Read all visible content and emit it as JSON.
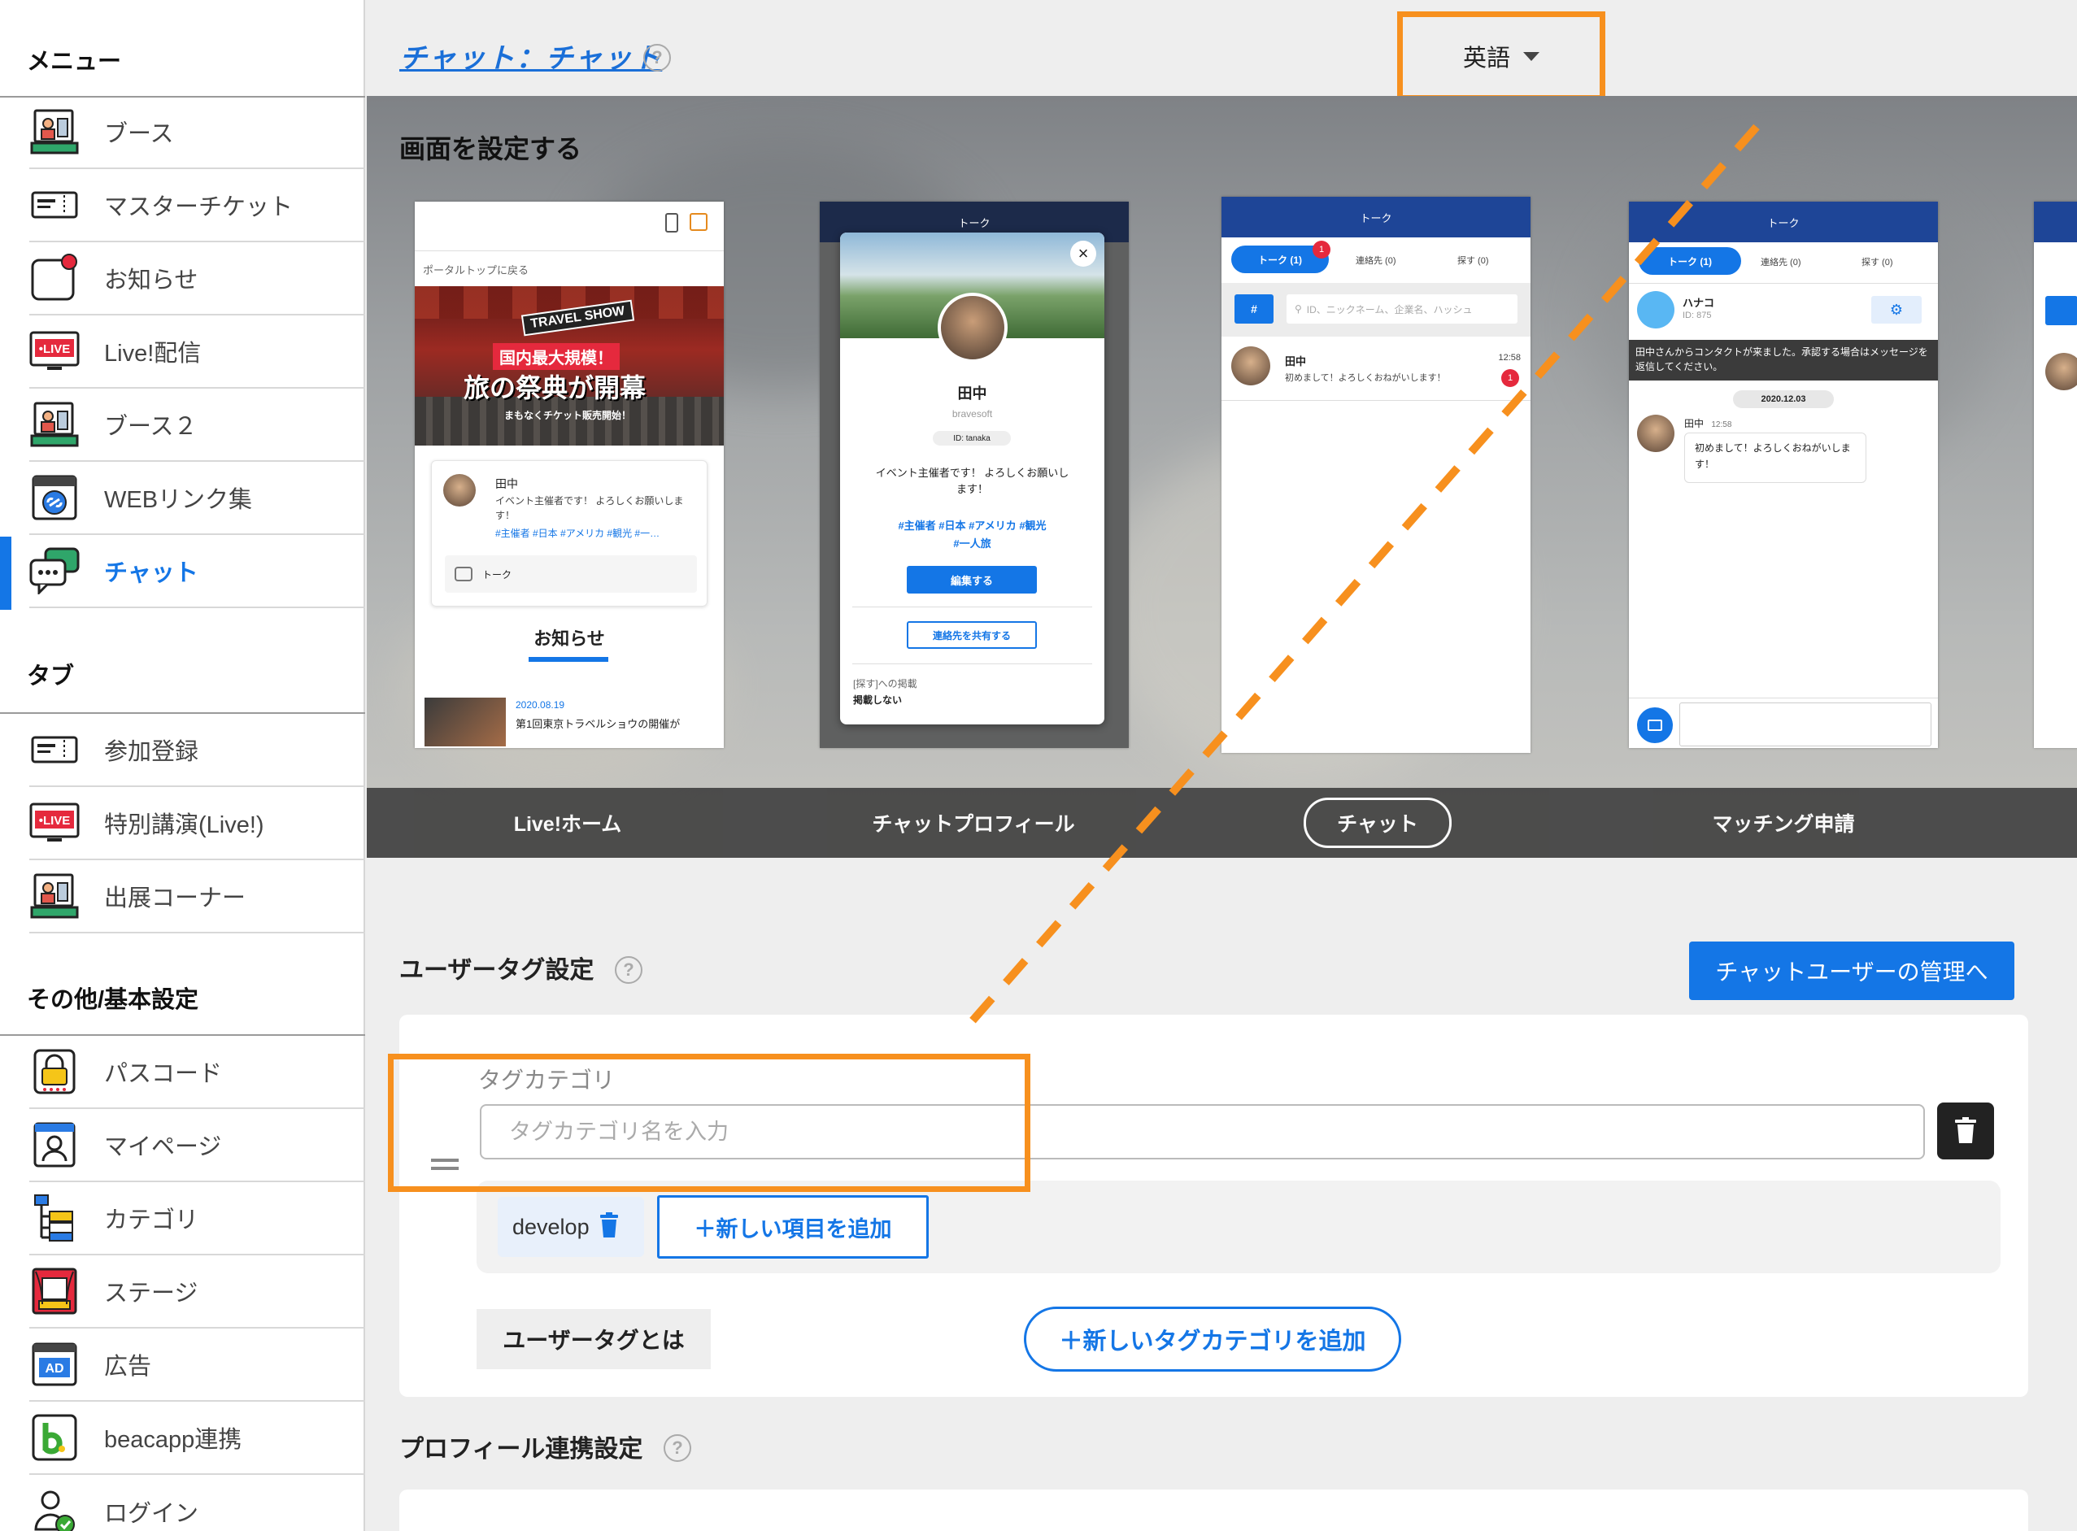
{
  "sidebar": {
    "menu_title": "メニュー",
    "tabs_title": "タブ",
    "other_title": "その他/基本設定",
    "menu_items": [
      {
        "label": "ブース",
        "icon": "booth-icon"
      },
      {
        "label": "マスターチケット",
        "icon": "ticket-icon"
      },
      {
        "label": "お知らせ",
        "icon": "notification-icon"
      },
      {
        "label": "Live!配信",
        "icon": "live-icon"
      },
      {
        "label": "ブース２",
        "icon": "booth-icon"
      },
      {
        "label": "WEBリンク集",
        "icon": "link-icon"
      },
      {
        "label": "チャット",
        "icon": "chat-icon",
        "active": true
      }
    ],
    "tab_items": [
      {
        "label": "参加登録",
        "icon": "ticket-icon"
      },
      {
        "label": "特別講演(Live!)",
        "icon": "live-icon"
      },
      {
        "label": "出展コーナー",
        "icon": "booth-icon"
      }
    ],
    "other_items": [
      {
        "label": "パスコード",
        "icon": "lock-icon"
      },
      {
        "label": "マイページ",
        "icon": "mypage-icon"
      },
      {
        "label": "カテゴリ",
        "icon": "category-icon"
      },
      {
        "label": "ステージ",
        "icon": "stage-icon"
      },
      {
        "label": "広告",
        "icon": "ad-icon"
      },
      {
        "label": "beacapp連携",
        "icon": "beacapp-icon"
      },
      {
        "label": "ログイン",
        "icon": "login-icon"
      }
    ],
    "live_badge": "•LIVE",
    "ad_badge": "AD"
  },
  "header": {
    "title": "チャット：チャット",
    "help": "?",
    "language": "英語"
  },
  "preview": {
    "title": "画面を設定する",
    "tabs": [
      "Live!ホーム",
      "チャットプロフィール",
      "チャット",
      "マッチング申請"
    ],
    "selected_tab": "チャット",
    "phone1": {
      "back_link": "ポータルトップに戻る",
      "banner_brand": "TRAVEL SHOW",
      "banner_line1": "国内最大規模！",
      "banner_line2": "旅の祭典が開幕",
      "banner_line3": "まもなくチケット販売開始！",
      "user_name": "田中",
      "user_msg": "イベント主催者です！ よろしくお願いします！",
      "user_tags": "#主催者 #日本 #アメリカ #観光 #一…",
      "talk": "トーク",
      "news_title": "お知らせ",
      "news_date": "2020.08.19",
      "news_text": "第1回東京トラベルショウの開催が"
    },
    "phone2": {
      "header": "トーク",
      "close": "×",
      "name": "田中",
      "company": "bravesoft",
      "id": "ID: tanaka",
      "msg": "イベント主催者です！ よろしくお願いします！",
      "tags1": "#主催者 #日本 #アメリカ #観光",
      "tags2": "#一人旅",
      "edit_btn": "編集する",
      "share_btn": "連絡先を共有する",
      "search_label": "[探す]への掲載",
      "search_value": "掲載しない"
    },
    "phone3": {
      "header": "トーク",
      "tab_talk": "トーク (1)",
      "tab_contacts": "連絡先 (0)",
      "tab_search": "探す (0)",
      "badge": "1",
      "hash": "#",
      "search_placeholder": "ID、ニックネーム、企業名、ハッシュ",
      "chat_name": "田中",
      "chat_msg": "初めまして！よろしくおねがいします！",
      "chat_time": "12:58",
      "chat_badge": "1"
    },
    "phone4": {
      "header": "トーク",
      "tab_talk": "トーク (1)",
      "tab_contacts": "連絡先 (0)",
      "tab_search": "探す (0)",
      "contact_name": "ハナコ",
      "contact_id": "ID: 875",
      "notice": "田中さんからコンタクトが来ました。承認する場合はメッセージを返信してください。",
      "date": "2020.12.03",
      "msg_name": "田中",
      "msg_time": "12:58",
      "msg_text": "初めまして！よろしくおねがいします！"
    }
  },
  "user_tags": {
    "heading": "ユーザータグ設定",
    "manage_button": "チャットユーザーの管理へ",
    "category_label": "タグカテゴリ",
    "category_placeholder": "タグカテゴリ名を入力",
    "category_value": "",
    "item_chip": "develop",
    "add_item_button": "＋新しい項目を追加",
    "what_is_button": "ユーザータグとは",
    "add_category_button": "＋新しいタグカテゴリを追加"
  },
  "profile_link": {
    "heading": "プロフィール連携設定"
  },
  "colors": {
    "accent": "#1476e6",
    "highlight": "#f7901e",
    "nav_dark": "#1e4597"
  }
}
